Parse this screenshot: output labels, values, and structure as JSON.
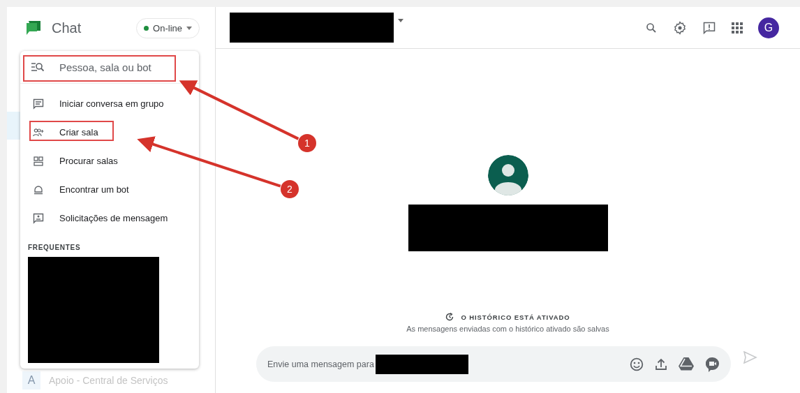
{
  "sidebar": {
    "app_name": "Chat",
    "status": {
      "label": "On-line"
    },
    "background_items": [
      {
        "avatar": "A",
        "name": "Apoio - Central de Serviços"
      }
    ]
  },
  "menu": {
    "search": {
      "placeholder": "Pessoa, sala ou bot",
      "highlighted": true
    },
    "items": [
      {
        "label": "Iniciar conversa em grupo",
        "highlighted": false
      },
      {
        "label": "Criar sala",
        "highlighted": true
      },
      {
        "label": "Procurar salas",
        "highlighted": false
      },
      {
        "label": "Encontrar um bot",
        "highlighted": false
      },
      {
        "label": "Solicitações de mensagem",
        "highlighted": false
      }
    ],
    "section_title": "FREQUENTES"
  },
  "header": {
    "avatar": "G"
  },
  "conversation": {
    "history_title": "O HISTÓRICO ESTÁ ATIVADO",
    "history_note": "As mensagens enviadas com o histórico ativado são salvas"
  },
  "composer": {
    "prompt": "Envie uma mensagem para"
  },
  "callouts": [
    {
      "number": "1"
    },
    {
      "number": "2"
    }
  ]
}
